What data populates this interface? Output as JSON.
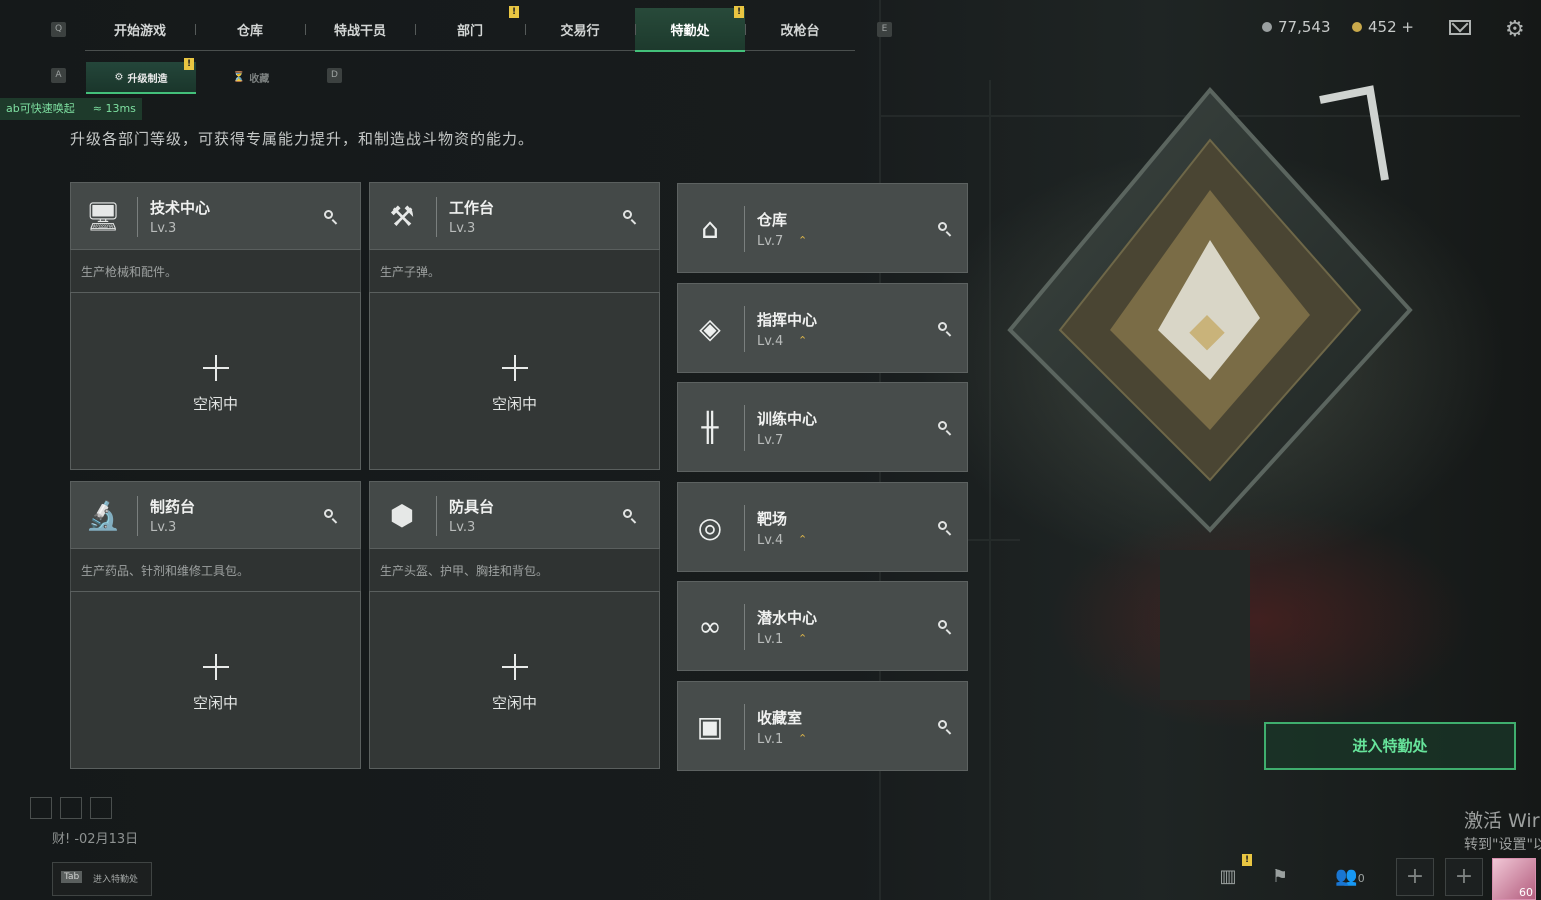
{
  "top_nav": {
    "left_key": "Q",
    "right_key": "E",
    "tabs": [
      {
        "label": "开始游戏"
      },
      {
        "label": "仓库"
      },
      {
        "label": "特战干员"
      },
      {
        "label": "部门"
      },
      {
        "label": "交易行"
      },
      {
        "label": "特勤处"
      },
      {
        "label": "改枪台"
      }
    ],
    "active_tab": "特勤处"
  },
  "currency": {
    "silver": "77,543",
    "gold": "452 +",
    "silver_color": "#9aa0a0",
    "gold_color": "#c9a94b"
  },
  "sub_nav": {
    "left_key": "A",
    "right_key": "D",
    "tabs": [
      {
        "label": "升级制造"
      },
      {
        "label": "收藏"
      }
    ]
  },
  "overlay": {
    "tip": "ab可快速唤起",
    "ping": "13ms"
  },
  "subtitle": "升级各部门等级，可获得专属能力提升，和制造战斗物资的能力。",
  "production_cards": [
    {
      "name": "技术中心",
      "level": "Lv.3",
      "desc": "生产枪械和配件。",
      "status": "空闲中",
      "icon": "monitor-icon"
    },
    {
      "name": "工作台",
      "level": "Lv.3",
      "desc": "生产子弹。",
      "status": "空闲中",
      "icon": "tools-icon"
    },
    {
      "name": "制药台",
      "level": "Lv.3",
      "desc": "生产药品、针剂和维修工具包。",
      "status": "空闲中",
      "icon": "microscope-icon"
    },
    {
      "name": "防具台",
      "level": "Lv.3",
      "desc": "生产头盔、护甲、胸挂和背包。",
      "status": "空闲中",
      "icon": "armor-icon"
    }
  ],
  "departments": [
    {
      "name": "仓库",
      "level": "Lv.7",
      "icon": "warehouse-icon"
    },
    {
      "name": "指挥中心",
      "level": "Lv.4",
      "icon": "command-icon"
    },
    {
      "name": "训练中心",
      "level": "Lv.7",
      "icon": "dumbbell-icon"
    },
    {
      "name": "靶场",
      "level": "Lv.4",
      "icon": "target-icon"
    },
    {
      "name": "潜水中心",
      "level": "Lv.1",
      "icon": "diving-mask-icon"
    },
    {
      "name": "收藏室",
      "level": "Lv.1",
      "icon": "collection-icon"
    }
  ],
  "enter_button": "进入特勤处",
  "bottom_left": {
    "date": "财! -02月13日",
    "tab_key": "Tab",
    "tab_label": "进入特勤处"
  },
  "watermark": {
    "line1": "激活 Wir",
    "line2": "转到\"设置\"以"
  },
  "bottom_right": {
    "friends_count": "0",
    "avatar_level": "60"
  }
}
